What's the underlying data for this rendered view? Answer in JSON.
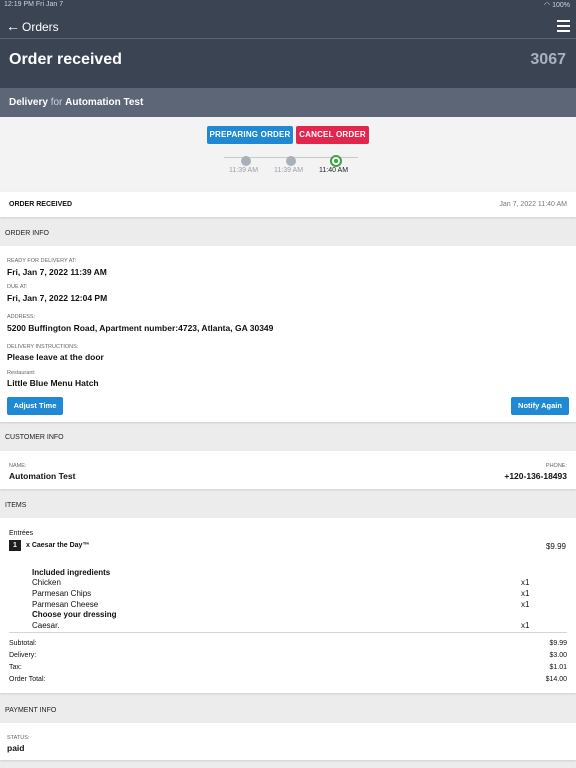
{
  "statusbar": {
    "time": "12:19 PM   Fri Jan 7",
    "battery": "100%"
  },
  "nav": {
    "back_label": "Orders"
  },
  "order": {
    "title": "Order received",
    "number": "3067"
  },
  "delivery": {
    "type": "Delivery",
    "for_text": "for",
    "customer": "Automation Test"
  },
  "actions": {
    "preparing_label": "PREPARING ORDER",
    "cancel_label": "CANCEL ORDER"
  },
  "timeline": [
    {
      "time": "11:39 AM",
      "state": "done"
    },
    {
      "time": "11:39 AM",
      "state": "done"
    },
    {
      "time": "11:40 AM",
      "state": "current"
    }
  ],
  "status_row": {
    "label": "ORDER RECEIVED",
    "timestamp": "Jan 7, 2022 11:40 AM"
  },
  "order_info": {
    "heading": "ORDER INFO",
    "ready_label": "READY FOR DELIVERY AT:",
    "ready_value": "Fri, Jan 7, 2022 11:39 AM",
    "due_label": "DUE AT:",
    "due_value": "Fri, Jan 7, 2022 12:04 PM",
    "address_label": "ADDRESS:",
    "address_value": "5200 Buffington Road, Apartment number:4723, Atlanta, GA 30349",
    "instructions_label": "DELIVERY INSTRUCTIONS:",
    "instructions_value": "Please leave at the door",
    "restaurant_label": "Restaurant:",
    "restaurant_value": "Little Blue Menu Hatch",
    "adjust_label": "Adjust Time",
    "notify_label": "Notify Again"
  },
  "customer_info": {
    "heading": "CUSTOMER INFO",
    "name_label": "NAME:",
    "name_value": "Automation Test",
    "phone_label": "PHONE:",
    "phone_value": "+120-136-18493"
  },
  "items": {
    "heading": "ITEMS",
    "category": "Entrées",
    "item_qty": "1",
    "item_name": "x Caesar the Day™",
    "item_price": "$9.99",
    "included_heading": "Included ingredients",
    "ingredients": [
      {
        "name": "Chicken",
        "qty": "x1"
      },
      {
        "name": "Parmesan Chips",
        "qty": "x1"
      },
      {
        "name": "Parmesan Cheese",
        "qty": "x1"
      }
    ],
    "dressing_heading": "Choose your dressing",
    "dressing": {
      "name": "Caesar.",
      "qty": "x1"
    }
  },
  "totals": [
    {
      "label": "Subtotal:",
      "value": "$9.99"
    },
    {
      "label": "Delivery:",
      "value": "$3.00"
    },
    {
      "label": "Tax:",
      "value": "$1.01"
    },
    {
      "label": "Order Total:",
      "value": "$14.00"
    }
  ],
  "payment": {
    "heading": "PAYMENT INFO",
    "status_label": "STATUS:",
    "status_value": "paid"
  }
}
